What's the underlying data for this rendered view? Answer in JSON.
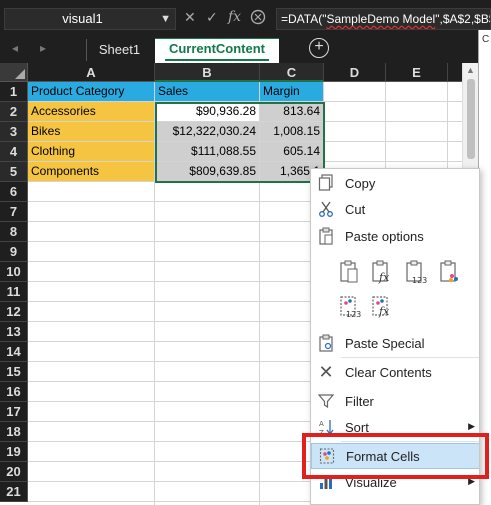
{
  "formula_bar": {
    "name_box": "visual1",
    "formula_prefix": "=DATA(\"",
    "formula_squiggle": "SampleDemo Model",
    "formula_suffix": "\",$A$2,$B$"
  },
  "tabs": {
    "sheet1": "Sheet1",
    "current": "CurrentContent"
  },
  "grid": {
    "columns": [
      "A",
      "B",
      "C",
      "D",
      "E"
    ],
    "rows": [
      "1",
      "2",
      "3",
      "4",
      "5",
      "6",
      "7",
      "8",
      "9",
      "10",
      "11",
      "12",
      "13",
      "14",
      "15",
      "16",
      "17",
      "18",
      "19",
      "20",
      "21"
    ],
    "headers": [
      "Product Category",
      "Sales",
      "Margin"
    ],
    "data": [
      [
        "Accessories",
        "$90,936.28",
        "813.64"
      ],
      [
        "Bikes",
        "$12,322,030.24",
        "1,008.15"
      ],
      [
        "Clothing",
        "$111,088.55",
        "605.14"
      ],
      [
        "Components",
        "$809,639.85",
        "1,365.1"
      ]
    ]
  },
  "context_menu": {
    "copy": "Copy",
    "cut": "Cut",
    "paste_options": "Paste options",
    "paste_special": "Paste Special",
    "clear_contents": "Clear Contents",
    "filter": "Filter",
    "sort": "Sort",
    "format_cells": "Format Cells",
    "visualize": "Visualize"
  },
  "colors": {
    "header_blue": "#29abe2",
    "category_yellow": "#f5c542",
    "selection_green": "#217346",
    "highlight_red": "#e0201c"
  }
}
